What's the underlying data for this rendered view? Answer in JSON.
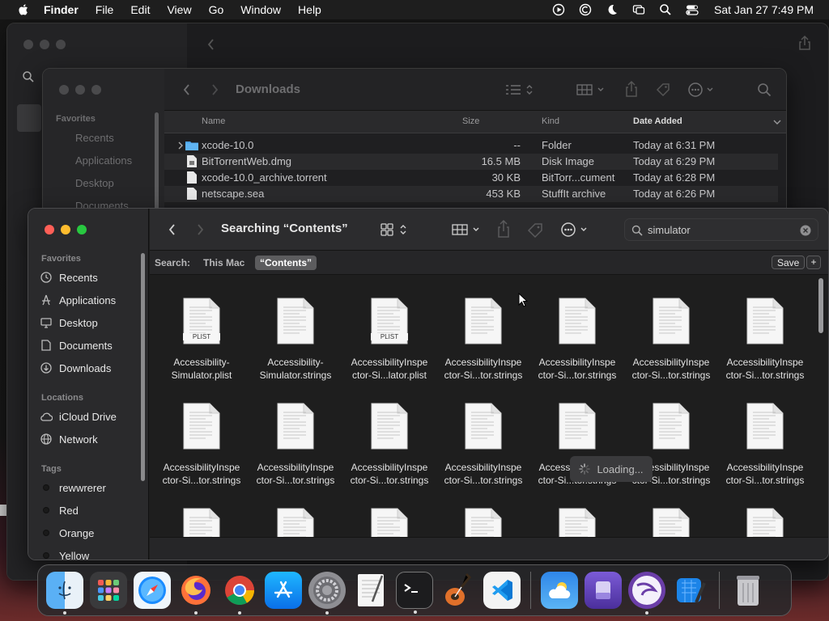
{
  "menubar": {
    "app_name": "Finder",
    "items": [
      "File",
      "Edit",
      "View",
      "Go",
      "Window",
      "Help"
    ],
    "clock": "Sat Jan 27  7:49 PM"
  },
  "back_window": {
    "title": "Downloads",
    "sidebar": {
      "heading": "Favorites",
      "items": [
        "Recents",
        "Applications",
        "Desktop",
        "Documents"
      ]
    },
    "columns": {
      "name": "Name",
      "size": "Size",
      "kind": "Kind",
      "date": "Date Added"
    },
    "rows": [
      {
        "name": "xcode-10.0",
        "size": "--",
        "kind": "Folder",
        "date": "Today at 6:31 PM"
      },
      {
        "name": "BitTorrentWeb.dmg",
        "size": "16.5 MB",
        "kind": "Disk Image",
        "date": "Today at 6:29 PM"
      },
      {
        "name": "xcode-10.0_archive.torrent",
        "size": "30 KB",
        "kind": "BitTorr...cument",
        "date": "Today at 6:28 PM"
      },
      {
        "name": "netscape.sea",
        "size": "453 KB",
        "kind": "StuffIt archive",
        "date": "Today at 6:26 PM"
      }
    ]
  },
  "front_window": {
    "title": "Searching “Contents”",
    "search_value": "simulator",
    "scope": {
      "label": "Search:",
      "this_mac": "This Mac",
      "contents": "“Contents”",
      "save": "Save",
      "add": "+"
    },
    "sidebar": {
      "favorites_heading": "Favorites",
      "favorites": [
        "Recents",
        "Applications",
        "Desktop",
        "Documents",
        "Downloads"
      ],
      "locations_heading": "Locations",
      "locations": [
        "iCloud Drive",
        "Network"
      ],
      "tags_heading": "Tags",
      "tags": [
        "rewwrerer",
        "Red",
        "Orange",
        "Yellow"
      ]
    },
    "loading": "Loading...",
    "files_row1": [
      {
        "line1": "Accessibility-",
        "line2": "Simulator.plist",
        "badge": "PLIST"
      },
      {
        "line1": "Accessibility-",
        "line2": "Simulator.strings",
        "badge": ""
      },
      {
        "line1": "AccessibilityInspe",
        "line2": "ctor-Si...lator.plist",
        "badge": "PLIST"
      },
      {
        "line1": "AccessibilityInspe",
        "line2": "ctor-Si...tor.strings",
        "badge": ""
      },
      {
        "line1": "AccessibilityInspe",
        "line2": "ctor-Si...tor.strings",
        "badge": ""
      },
      {
        "line1": "AccessibilityInspe",
        "line2": "ctor-Si...tor.strings",
        "badge": ""
      },
      {
        "line1": "AccessibilityInspe",
        "line2": "ctor-Si...tor.strings",
        "badge": ""
      }
    ],
    "files_row2": [
      {
        "line1": "AccessibilityInspe",
        "line2": "ctor-Si...tor.strings"
      },
      {
        "line1": "AccessibilityInspe",
        "line2": "ctor-Si...tor.strings"
      },
      {
        "line1": "AccessibilityInspe",
        "line2": "ctor-Si...tor.strings"
      },
      {
        "line1": "AccessibilityInspe",
        "line2": "ctor-Si...tor.strings"
      },
      {
        "line1": "AccessibilityInspe",
        "line2": "ctor-Si...tor.strings"
      },
      {
        "line1": "AccessibilityInspe",
        "line2": "ctor-Si...tor.strings"
      },
      {
        "line1": "AccessibilityInspe",
        "line2": "ctor-Si...tor.strings"
      }
    ]
  },
  "dock": {
    "apps": [
      "finder-icon",
      "launchpad-icon",
      "safari-icon",
      "firefox-icon",
      "chrome-icon",
      "app-store-icon",
      "system-preferences-icon",
      "textedit-icon",
      "terminal-icon",
      "garageband-icon",
      "vscode-icon",
      "weather-icon",
      "disk-utility-icon",
      "bittorrent-icon",
      "xcode-icon",
      "trash-icon"
    ]
  },
  "colors": {
    "accent": "#0a84ff",
    "red": "#ff5f57",
    "yellow": "#febc2e",
    "green": "#28c840"
  }
}
